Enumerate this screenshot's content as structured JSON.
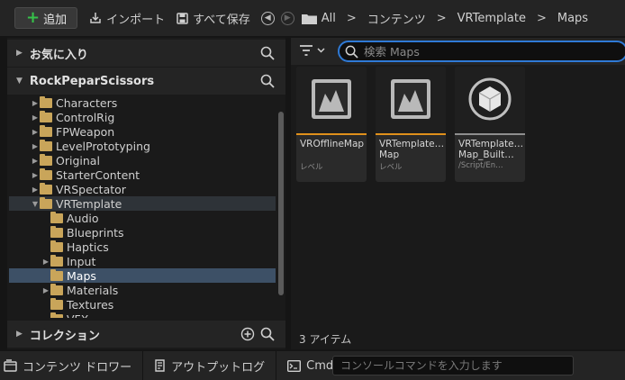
{
  "toolbar": {
    "add_label": "追加",
    "import_label": "インポート",
    "save_all_label": "すべて保存",
    "breadcrumb": [
      "All",
      "コンテンツ",
      "VRTemplate",
      "Maps"
    ]
  },
  "left_panel": {
    "favorites_label": "お気に入り",
    "project_label": "RockPeparScissors",
    "collections_label": "コレクション",
    "tree": [
      {
        "label": "Characters",
        "depth": 0,
        "expandable": true,
        "open": false
      },
      {
        "label": "ControlRig",
        "depth": 0,
        "expandable": true,
        "open": false
      },
      {
        "label": "FPWeapon",
        "depth": 0,
        "expandable": true,
        "open": false
      },
      {
        "label": "LevelPrototyping",
        "depth": 0,
        "expandable": true,
        "open": false
      },
      {
        "label": "Original",
        "depth": 0,
        "expandable": true,
        "open": false
      },
      {
        "label": "StarterContent",
        "depth": 0,
        "expandable": true,
        "open": false
      },
      {
        "label": "VRSpectator",
        "depth": 0,
        "expandable": true,
        "open": false
      },
      {
        "label": "VRTemplate",
        "depth": 0,
        "expandable": true,
        "open": true
      },
      {
        "label": "Audio",
        "depth": 1,
        "expandable": false,
        "open": false
      },
      {
        "label": "Blueprints",
        "depth": 1,
        "expandable": false,
        "open": false
      },
      {
        "label": "Haptics",
        "depth": 1,
        "expandable": false,
        "open": false
      },
      {
        "label": "Input",
        "depth": 1,
        "expandable": true,
        "open": false
      },
      {
        "label": "Maps",
        "depth": 1,
        "expandable": false,
        "open": false,
        "selected": true
      },
      {
        "label": "Materials",
        "depth": 1,
        "expandable": true,
        "open": false
      },
      {
        "label": "Textures",
        "depth": 1,
        "expandable": false,
        "open": false
      },
      {
        "label": "VFX",
        "depth": 1,
        "expandable": false,
        "open": false
      }
    ]
  },
  "content": {
    "search_placeholder": "検索 Maps",
    "items_count": "3 アイテム",
    "assets": [
      {
        "name": "VROfflineMap",
        "sub": "レベル",
        "icon": "level-map-icon",
        "color": "#e0901b"
      },
      {
        "name": "VRTemplate…\nMap",
        "sub": "レベル",
        "icon": "level-map-icon",
        "color": "#e0901b"
      },
      {
        "name": "VRTemplate…\nMap_Built…",
        "sub": "/Script/En…",
        "icon": "build-data-icon",
        "color": "#8e8e8e"
      }
    ]
  },
  "bottom_bar": {
    "content_drawer_label": "コンテンツ ドロワー",
    "output_log_label": "アウトプットログ",
    "cmd_label": "Cmd",
    "console_placeholder": "コンソールコマンドを入力します"
  }
}
